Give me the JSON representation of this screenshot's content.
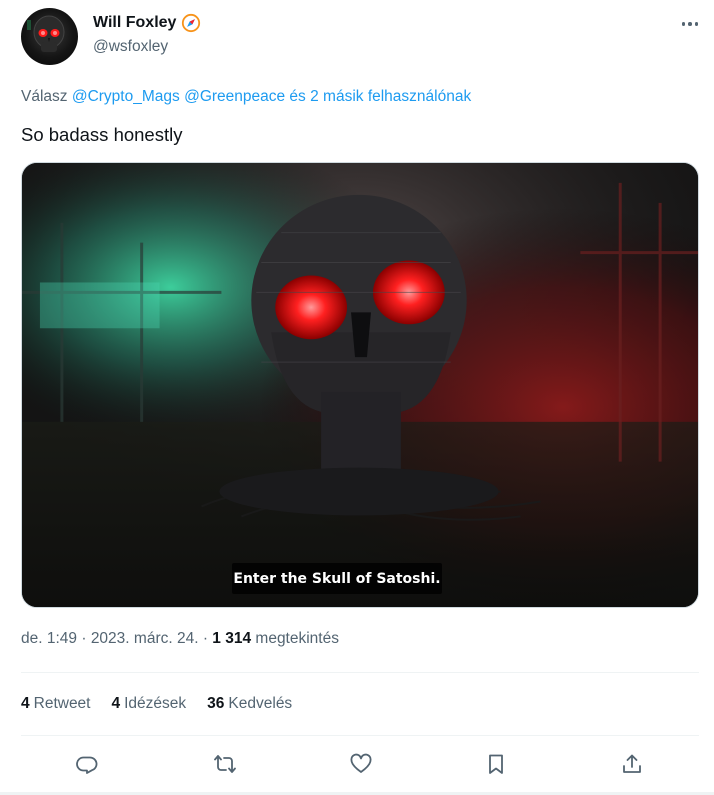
{
  "author": {
    "display_name": "Will Foxley",
    "handle": "@wsfoxley",
    "badge_icon": "verified-compass-badge-icon",
    "avatar_icon": "skull-avatar"
  },
  "more_icon": "more-dots-icon",
  "reply": {
    "prefix": "Válasz ",
    "mention1": "@Crypto_Mags",
    "mention2": "@Greenpeace",
    "suffix": " és 2 másik felhasználónak"
  },
  "tweet_text": "So badass honestly",
  "media": {
    "caption": "Enter the Skull of Satoshi."
  },
  "meta": {
    "time": "de. 1:49",
    "date": "2023. márc. 24.",
    "views_count": "1 314",
    "views_label": "megtekintés"
  },
  "stats": [
    {
      "count": "4",
      "label": "Retweet"
    },
    {
      "count": "4",
      "label": "Idézések"
    },
    {
      "count": "36",
      "label": "Kedvelés"
    }
  ],
  "actions": [
    "reply-icon",
    "retweet-icon",
    "like-icon",
    "bookmark-icon",
    "share-icon"
  ],
  "colors": {
    "link": "#1d9bf0",
    "secondary_text": "#536471",
    "primary_text": "#0f1419",
    "divider": "#eff3f4"
  }
}
